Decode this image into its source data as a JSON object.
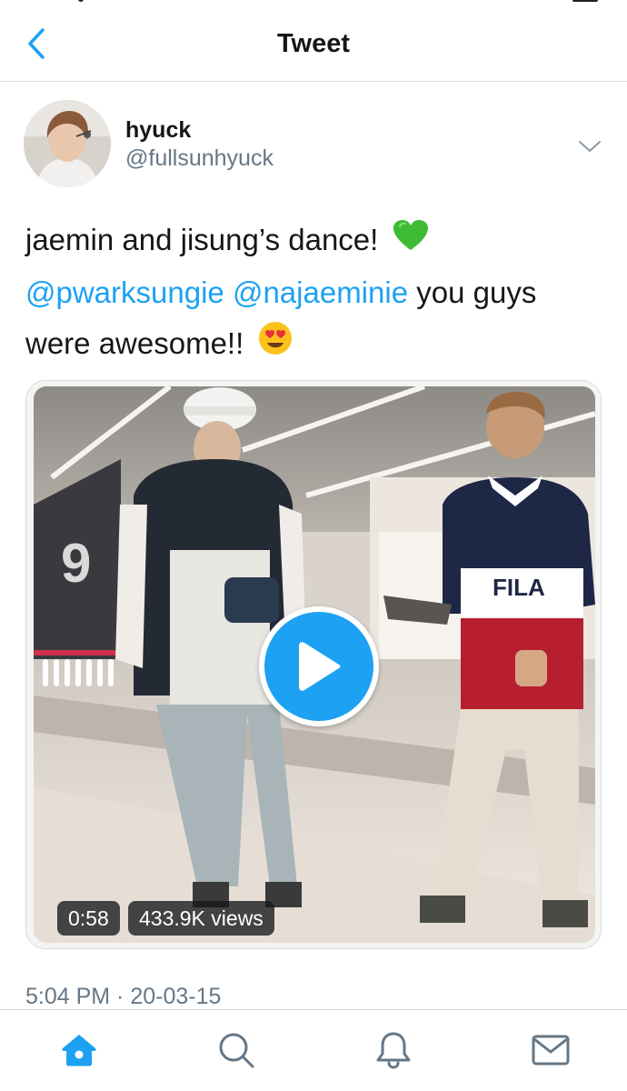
{
  "colors": {
    "accent": "#1da1f2",
    "text_primary": "#14171a",
    "text_secondary": "#657786",
    "divider": "#d7dbdf"
  },
  "header": {
    "title": "Tweet",
    "back_icon": "chevron-left-icon"
  },
  "tweet": {
    "author": {
      "display_name": "hyuck",
      "handle": "@fullsunhyuck"
    },
    "text": {
      "line1": "jaemin and jisung’s dance!",
      "line1_emoji": "green-heart-emoji",
      "mention1": "@pwarksungie",
      "mention2": "@najaeminie",
      "line2_rest": "you guys",
      "line3": "were awesome!!",
      "line3_emoji": "heart-eyes-emoji"
    },
    "media": {
      "type": "video",
      "duration": "0:58",
      "views": "433.9K views"
    },
    "timestamp": "5:04 PM · 20-03-15"
  },
  "tabbar": {
    "items": [
      {
        "icon": "home-icon",
        "active": true
      },
      {
        "icon": "search-icon",
        "active": false
      },
      {
        "icon": "bell-icon",
        "active": false
      },
      {
        "icon": "mail-icon",
        "active": false
      }
    ]
  }
}
